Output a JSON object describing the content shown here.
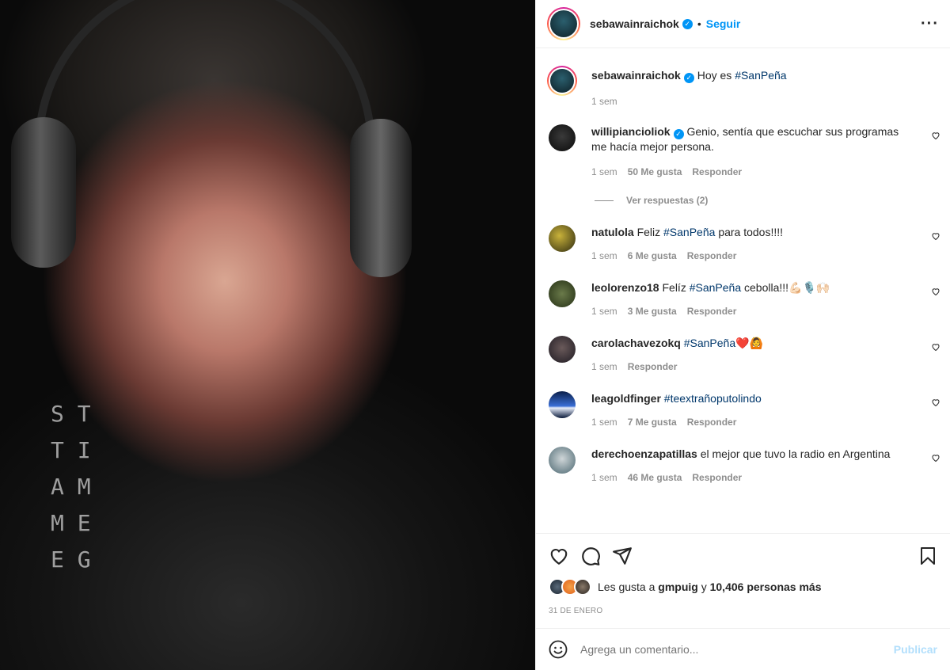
{
  "header": {
    "username": "sebawainraichok",
    "dot": "•",
    "follow_label": "Seguir",
    "more_label": "···"
  },
  "caption": {
    "username": "sebawainraichok",
    "text": "Hoy es",
    "hashtag": "#SanPeña",
    "time": "1 sem"
  },
  "comments": [
    {
      "username": "willipiancioliok",
      "verified": true,
      "text": "Genio, sentía que escuchar sus programas me hacía mejor persona.",
      "time": "1 sem",
      "likes": "50 Me gusta",
      "reply": "Responder",
      "replies": "Ver respuestas (2)"
    },
    {
      "username": "natulola",
      "text_before": "Feliz",
      "hashtag": "#SanPeña",
      "text_after": "para todos!!!!",
      "time": "1 sem",
      "likes": "6 Me gusta",
      "reply": "Responder"
    },
    {
      "username": "leolorenzo18",
      "text_before": "Felíz",
      "hashtag": "#SanPeña",
      "text_after": "cebolla!!!💪🏻🎙️🙌🏻",
      "time": "1 sem",
      "likes": "3 Me gusta",
      "reply": "Responder"
    },
    {
      "username": "carolachavezokq",
      "hashtag": "#SanPeña",
      "text_after": "❤️🙆",
      "time": "1 sem",
      "reply": "Responder"
    },
    {
      "username": "leagoldfinger",
      "hashtag": "#teextrañoputolindo",
      "time": "1 sem",
      "likes": "7 Me gusta",
      "reply": "Responder"
    },
    {
      "username": "derechoenzapatillas",
      "text_after": "el mejor que tuvo la radio en Argentina",
      "time": "1 sem",
      "likes": "46 Me gusta",
      "reply": "Responder"
    }
  ],
  "likes_line": {
    "prefix": "Les gusta a",
    "user": "gmpuig",
    "middle": "y",
    "count": "10,406 personas más"
  },
  "date": "31 DE ENERO",
  "add_comment": {
    "placeholder": "Agrega un comentario...",
    "publish_label": "Publicar"
  },
  "media": {
    "shirt_letters": [
      "S T",
      "T I",
      "A M",
      "M E",
      "E G"
    ]
  },
  "colors": {
    "accent": "#0095f6",
    "hashtag": "#00376b",
    "muted": "#8e8e8e"
  }
}
